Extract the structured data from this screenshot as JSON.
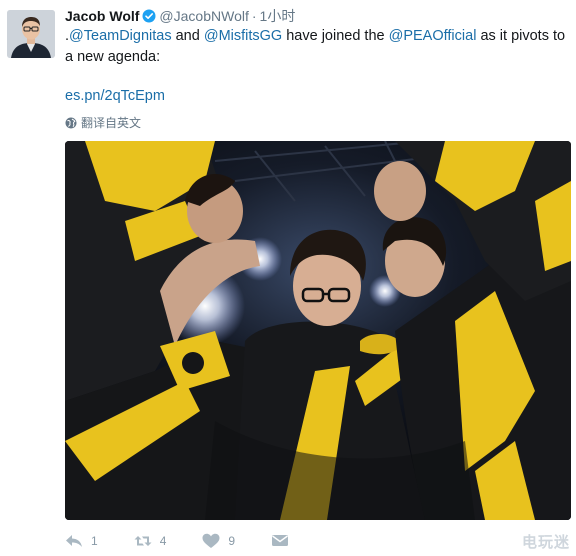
{
  "tweet": {
    "author_name": "Jacob Wolf",
    "handle": "@JacobNWolf",
    "separator": "·",
    "time": "1小时",
    "text_prefix": ".",
    "mention1": "@TeamDignitas",
    "text_and": " and ",
    "mention2": "@MisfitsGG",
    "text_have_joined": " have joined the ",
    "mention3": "@PEAOfficial",
    "text_suffix": " as it pivots to a new agenda:",
    "link": "es.pn/2qTcEpm",
    "translate_label": "翻译自英文",
    "reply_count": "1",
    "retweet_count": "4",
    "like_count": "9"
  },
  "watermark": "电玩迷",
  "icons": {
    "verified": "verified-badge-icon",
    "globe": "globe-icon",
    "reply": "reply-icon",
    "retweet": "retweet-icon",
    "like": "heart-icon",
    "dm": "direct-message-icon"
  },
  "colors": {
    "link": "#1b6ea8",
    "muted": "#657786",
    "verified": "#1da1f2",
    "photo_yellow": "#e8c21e"
  }
}
